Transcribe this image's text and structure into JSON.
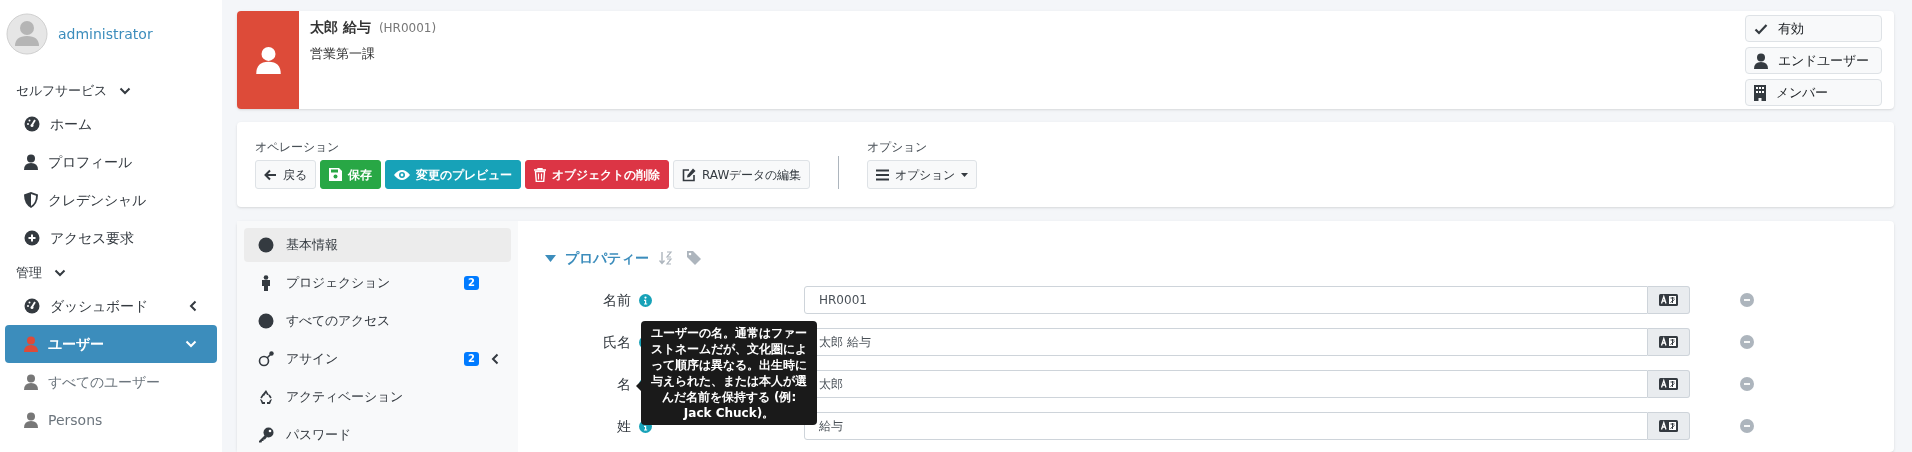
{
  "user": {
    "name": "administrator"
  },
  "sidebar": {
    "sections": [
      {
        "title": "セルフサービス",
        "expanded": true,
        "items": [
          {
            "label": "ホーム",
            "selected": false
          },
          {
            "label": "プロフィール",
            "selected": false
          },
          {
            "label": "クレデンシャル",
            "selected": false
          },
          {
            "label": "アクセス要求",
            "selected": false
          }
        ]
      },
      {
        "title": "管理",
        "expanded": true,
        "items": [
          {
            "label": "ダッシュボード",
            "selected": false,
            "expanded": false
          },
          {
            "label": "ユーザー",
            "selected": true,
            "expanded": true,
            "children": [
              {
                "label": "すべてのユーザー",
                "selected": false
              },
              {
                "label": "Persons",
                "selected": false
              }
            ]
          }
        ]
      }
    ]
  },
  "header": {
    "name": "太郎 給与",
    "id": "(HR0001)",
    "subtitle": "営業第一課",
    "badges": [
      "有効",
      "エンドユーザー",
      "メンバー"
    ]
  },
  "operations": {
    "title": "オペレーション",
    "buttons": [
      {
        "label": "戻る",
        "kind": "default"
      },
      {
        "label": "保存",
        "kind": "success"
      },
      {
        "label": "変更のプレビュー",
        "kind": "info"
      },
      {
        "label": "オブジェクトの削除",
        "kind": "danger"
      },
      {
        "label": "RAWデータの編集",
        "kind": "default"
      }
    ],
    "options_title": "オプション",
    "options_button": "オプション"
  },
  "tabs": [
    {
      "label": "基本情報",
      "selected": true
    },
    {
      "label": "プロジェクション",
      "selected": false,
      "badge": "2"
    },
    {
      "label": "すべてのアクセス",
      "selected": false
    },
    {
      "label": "アサイン",
      "selected": false,
      "badge": "2",
      "expanded": false
    },
    {
      "label": "アクティベーション",
      "selected": false
    },
    {
      "label": "パスワード",
      "selected": false
    }
  ],
  "properties": {
    "title": "プロパティー",
    "expanded": true,
    "fields": [
      {
        "label": "名前",
        "value": "HR0001"
      },
      {
        "label": "氏名",
        "value": "太郎 給与"
      },
      {
        "label": "名",
        "value": "太郎"
      },
      {
        "label": "姓",
        "value": "給与"
      }
    ]
  },
  "tooltip": {
    "text": "ユーザーの名。通常はファーストネームだが、文化圏によって順序は異なる。出生時に与えられた、または本人が選んだ名前を保持する (例: Jack Chuck)。"
  }
}
